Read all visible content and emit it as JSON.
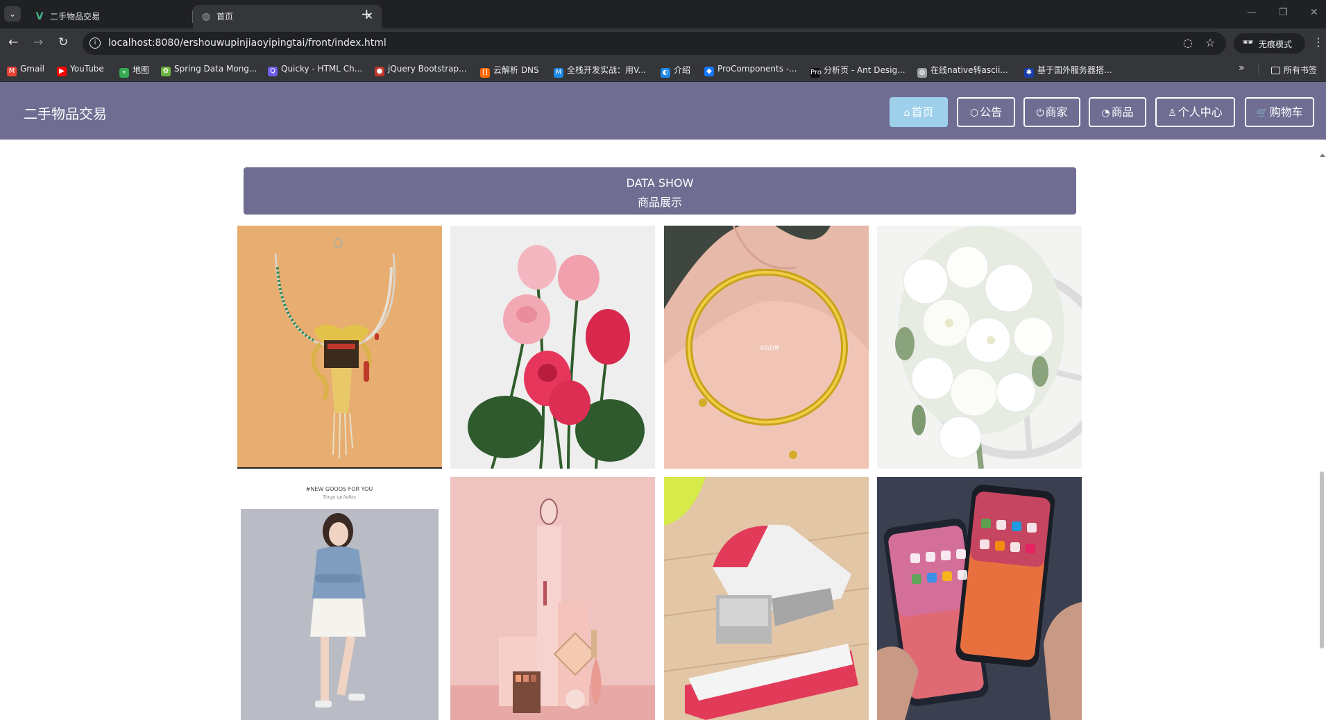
{
  "browser": {
    "tabs": [
      {
        "title": "二手物品交易",
        "favicon": "vue-logo-icon"
      },
      {
        "title": "首页",
        "favicon": "globe-icon"
      }
    ],
    "url": "localhost:8080/ershouwupinjiaoyipingtai/front/index.html",
    "incognito_label": "无痕模式",
    "bookmarks": [
      {
        "label": "Gmail",
        "icon": "gmail-icon",
        "color": "#ea4335"
      },
      {
        "label": "YouTube",
        "icon": "youtube-icon",
        "color": "#ff0000"
      },
      {
        "label": "地图",
        "icon": "maps-icon",
        "color": "#34a853"
      },
      {
        "label": "Spring Data Mong...",
        "icon": "spring-icon",
        "color": "#6db33f"
      },
      {
        "label": "Quicky - HTML Ch...",
        "icon": "quicky-icon",
        "color": "#6c5ce7"
      },
      {
        "label": "jQuery Bootstrap...",
        "icon": "jquery-icon",
        "color": "#c0392b"
      },
      {
        "label": "云解析 DNS",
        "icon": "aliyun-icon",
        "color": "#ff6a00"
      },
      {
        "label": "全栈开发实战：用V...",
        "icon": "m-icon",
        "color": "#1e88e5"
      },
      {
        "label": "介绍",
        "icon": "intro-icon",
        "color": "#1e88e5"
      },
      {
        "label": "ProComponents -...",
        "icon": "antd-icon",
        "color": "#1677ff"
      },
      {
        "label": "分析页 - Ant Desig...",
        "icon": "pro-icon",
        "color": "#111111"
      },
      {
        "label": "在线native转ascii...",
        "icon": "globe-icon",
        "color": "#9aa0a6"
      },
      {
        "label": "基于国外服务器搭...",
        "icon": "flag-icon",
        "color": "#1a3ea8"
      }
    ],
    "all_bookmarks_label": "所有书签"
  },
  "header": {
    "logo": "二手物品交易",
    "nav": [
      {
        "label": "首页",
        "icon": "home-icon",
        "active": true
      },
      {
        "label": "公告",
        "icon": "box-icon",
        "active": false
      },
      {
        "label": "商家",
        "icon": "power-icon",
        "active": false
      },
      {
        "label": "商品",
        "icon": "gauge-icon",
        "active": false
      },
      {
        "label": "个人中心",
        "icon": "user-icon",
        "active": false
      },
      {
        "label": "购物车",
        "icon": "cart-icon",
        "active": false
      }
    ]
  },
  "section": {
    "title_en": "DATA SHOW",
    "title_cn": "商品展示"
  },
  "products": [
    {
      "image": "necklace"
    },
    {
      "image": "pink-roses"
    },
    {
      "image": "gold-bangle",
      "watermark": "@拉拉熊"
    },
    {
      "image": "white-flowers"
    },
    {
      "image": "woman-fashion",
      "caption": "#NEW GOOOS FOR YOU",
      "sub": "Tonga up ladies"
    },
    {
      "image": "pink-cosmetics"
    },
    {
      "image": "stapler"
    },
    {
      "image": "iphones"
    }
  ]
}
